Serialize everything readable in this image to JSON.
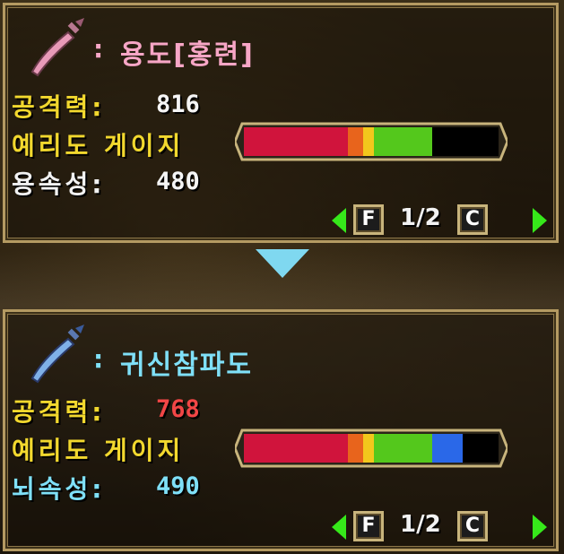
{
  "current": {
    "weapon_name": "용도[홍련]",
    "colon": ":",
    "attack_label": "공격력:",
    "attack_value": "816",
    "sharpness_label": "예리도 게이지",
    "element_label": "용속성:",
    "element_value": "480",
    "sharpness": [
      {
        "color": "#d0143c",
        "fraction": 0.41
      },
      {
        "color": "#e8641c",
        "fraction": 0.06
      },
      {
        "color": "#f2c81c",
        "fraction": 0.04
      },
      {
        "color": "#54c81c",
        "fraction": 0.23
      }
    ],
    "name_color": "#f7a6c6",
    "attack_color": "#f5f5f5",
    "element_color": "#f5f5f5"
  },
  "candidate": {
    "weapon_name": "귀신참파도",
    "colon": ":",
    "attack_label": "공격력:",
    "attack_value": "768",
    "sharpness_label": "예리도 게이지",
    "element_label": "뇌속성:",
    "element_value": "490",
    "sharpness": [
      {
        "color": "#d0143c",
        "fraction": 0.41
      },
      {
        "color": "#e8641c",
        "fraction": 0.06
      },
      {
        "color": "#f2c81c",
        "fraction": 0.04
      },
      {
        "color": "#54c81c",
        "fraction": 0.23
      },
      {
        "color": "#2a68e8",
        "fraction": 0.12
      }
    ],
    "name_color": "#7fe0f8",
    "attack_color": "#f24646",
    "element_color": "#7fe0f8"
  },
  "pager": {
    "prev_key": "F",
    "next_key": "C",
    "page_text": "1/2"
  },
  "icons": {
    "weapon_top": "long-sword-pink-icon",
    "weapon_bottom": "long-sword-blue-icon",
    "compare_arrow": "down-arrow-icon"
  }
}
